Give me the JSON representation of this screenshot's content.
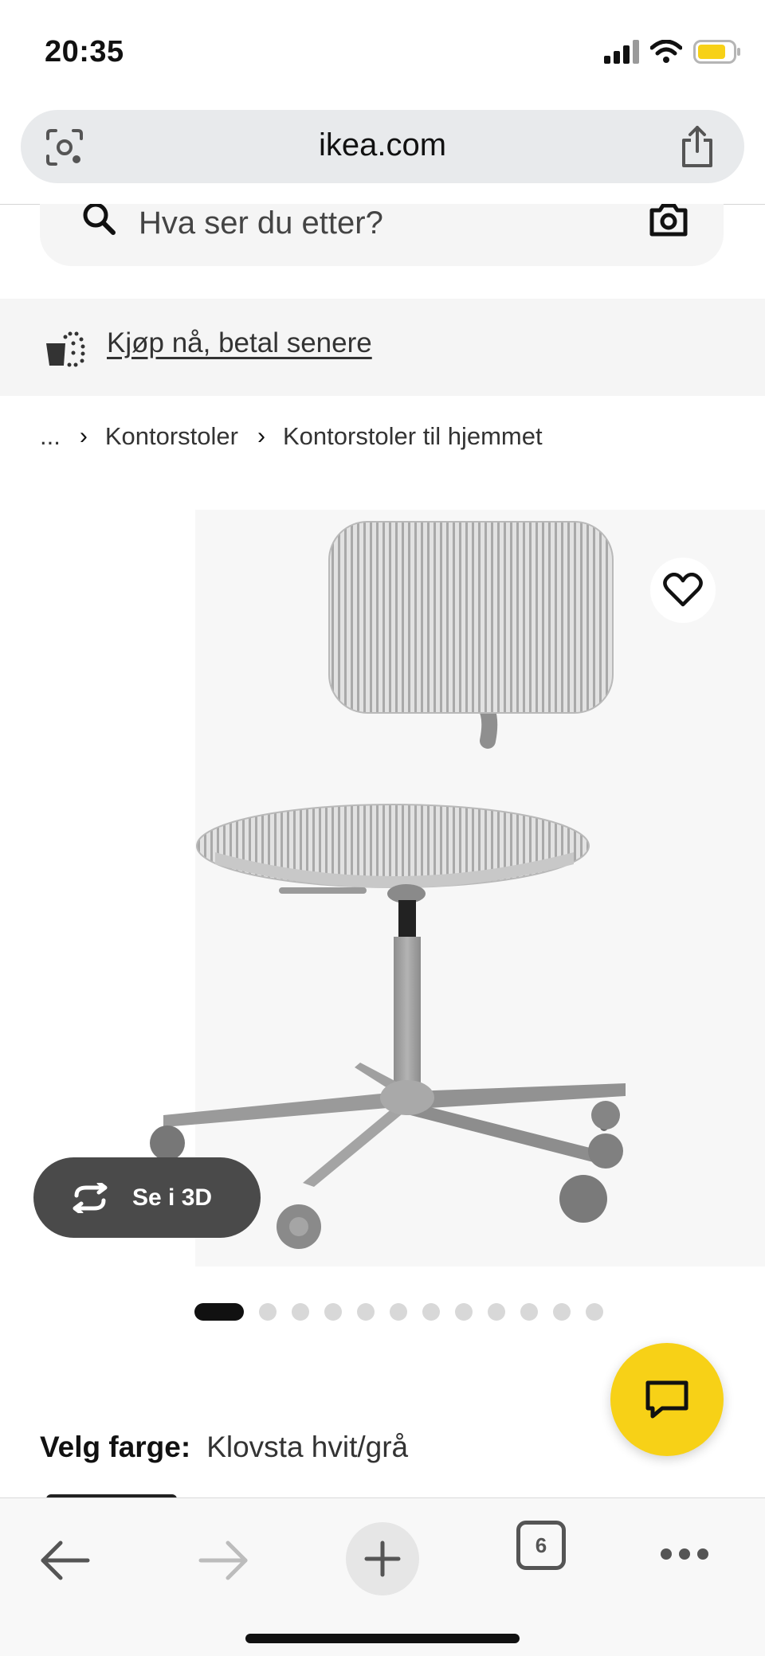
{
  "status_bar": {
    "time": "20:35",
    "icons": [
      "cellular-signal-icon",
      "wifi-icon",
      "battery-icon"
    ],
    "battery_color": "#f7d117"
  },
  "browser": {
    "url": "ikea.com",
    "icons": [
      "lens-icon",
      "share-icon"
    ]
  },
  "search": {
    "placeholder": "Hva ser du etter?",
    "icons": [
      "search-icon",
      "camera-icon"
    ]
  },
  "promo": {
    "link_text": "Kjøp nå, betal senere",
    "icon": "shopping-bag-icon"
  },
  "breadcrumb": {
    "items": [
      "...",
      "Kontorstoler",
      "Kontorstoler til hjemmet"
    ]
  },
  "product": {
    "view_3d_label": "Se i 3D",
    "image_count": 12,
    "active_image": 1,
    "color_label": "Velg farge:",
    "color_value": "Klovsta hvit/grå"
  },
  "fab": {
    "icon": "chat-icon",
    "color": "#f7d117"
  },
  "bottom_nav": {
    "tab_count": "6",
    "icons": [
      "back-arrow-icon",
      "forward-arrow-icon",
      "plus-icon",
      "tabs-icon",
      "more-icon"
    ]
  }
}
